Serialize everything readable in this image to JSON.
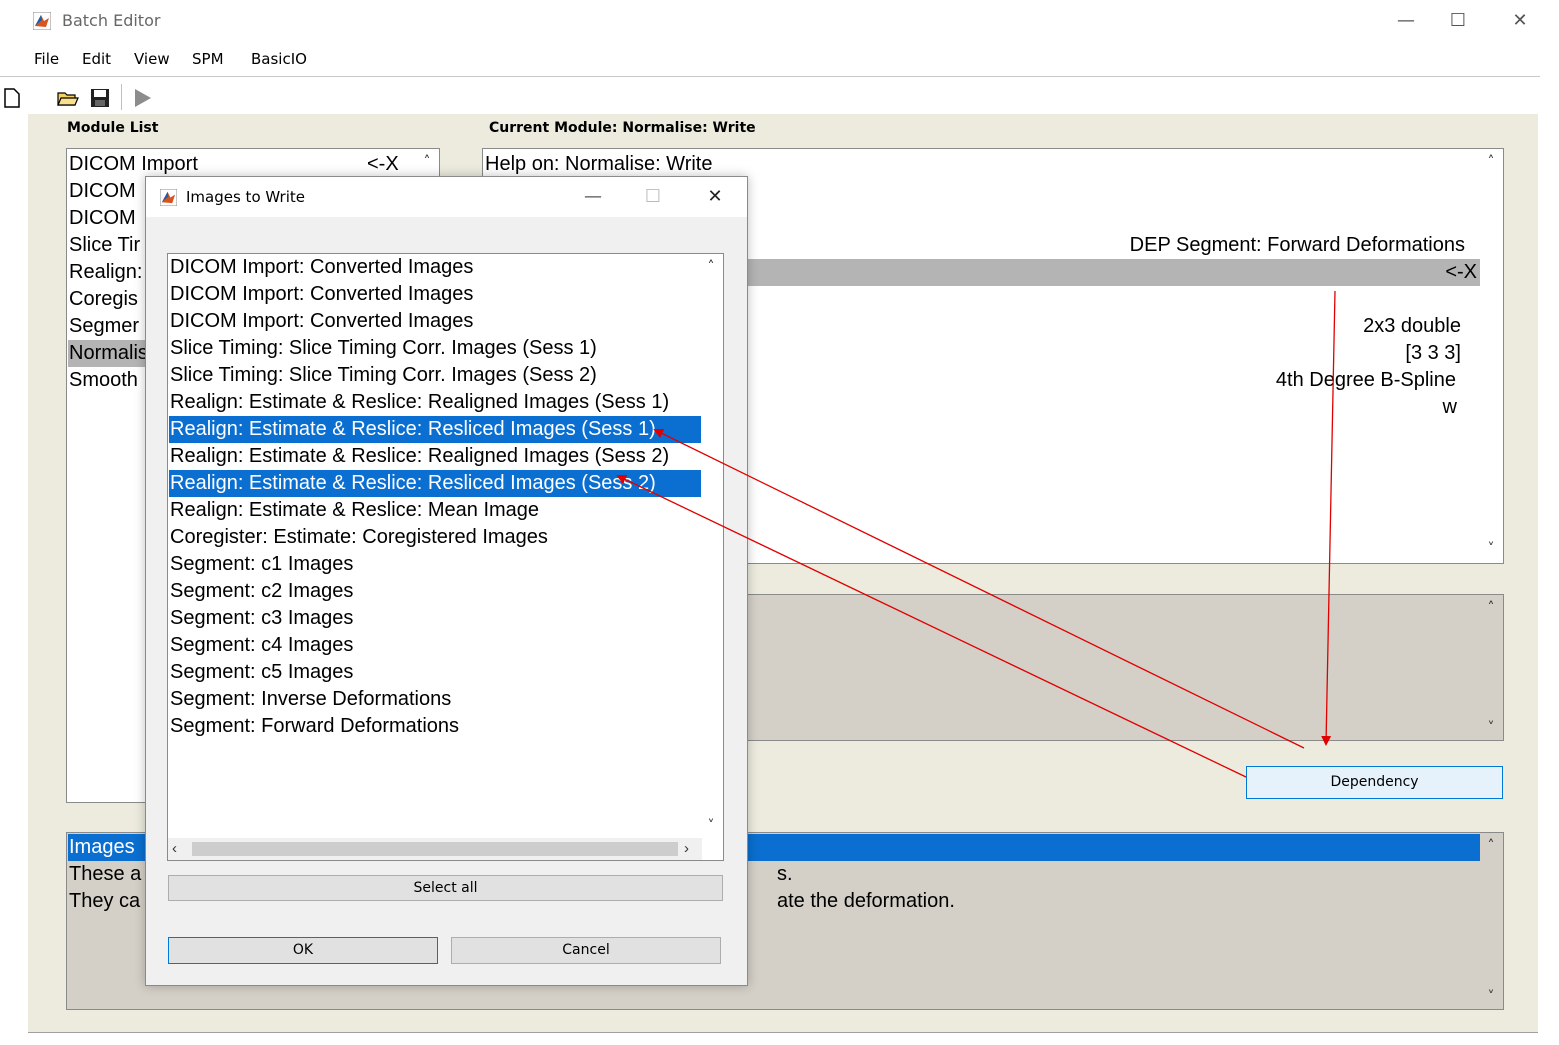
{
  "window": {
    "title": "Batch Editor",
    "controls": {
      "minimize": "—",
      "maximize": "☐",
      "close": "✕"
    }
  },
  "menubar": [
    "File",
    "Edit",
    "View",
    "SPM",
    "BasicIO"
  ],
  "toolbar": [
    "new-file-icon",
    "open-folder-icon",
    "save-icon",
    "run-icon"
  ],
  "module_list": {
    "caption": "Module List",
    "items": [
      "DICOM Import",
      "DICOM",
      "DICOM",
      "Slice Tir",
      "Realign:",
      "Coregis",
      "Segmer",
      "Normalis",
      "Smooth"
    ],
    "first_suffix": "<-X",
    "selected_index": 7
  },
  "current_module": {
    "caption": "Current Module: Normalise: Write",
    "help_line": "Help on: Normalise: Write",
    "dep_line": "DEP Segment: Forward Deformations",
    "selected_suffix": "<-X",
    "values": [
      "2x3 double",
      "[3 3 3]",
      "4th Degree B-Spline",
      "w"
    ]
  },
  "dependency_button": "Dependency",
  "help_panel": {
    "title": "Images",
    "line1_left": "These a",
    "line1_right": "s.",
    "line2_left": "They ca",
    "line2_right": "ate the deformation."
  },
  "dialog": {
    "title": "Images to Write",
    "controls": {
      "minimize": "—",
      "maximize": "☐",
      "close": "✕"
    },
    "items": [
      "DICOM Import: Converted Images",
      "DICOM Import: Converted Images",
      "DICOM Import: Converted Images",
      "Slice Timing: Slice Timing Corr. Images (Sess 1)",
      "Slice Timing: Slice Timing Corr. Images (Sess 2)",
      "Realign: Estimate & Reslice: Realigned Images (Sess 1)",
      "Realign: Estimate & Reslice: Resliced Images (Sess 1)",
      "Realign: Estimate & Reslice: Realigned Images (Sess 2)",
      "Realign: Estimate & Reslice: Resliced Images (Sess 2)",
      "Realign: Estimate & Reslice: Mean Image",
      "Coregister: Estimate: Coregistered Images",
      "Segment: c1 Images",
      "Segment: c2 Images",
      "Segment: c3 Images",
      "Segment: c4 Images",
      "Segment: c5 Images",
      "Segment: Inverse Deformations",
      "Segment: Forward Deformations"
    ],
    "selected_indices": [
      6,
      8
    ],
    "select_all": "Select all",
    "ok": "OK",
    "cancel": "Cancel"
  },
  "annotation_color": "#e00000"
}
